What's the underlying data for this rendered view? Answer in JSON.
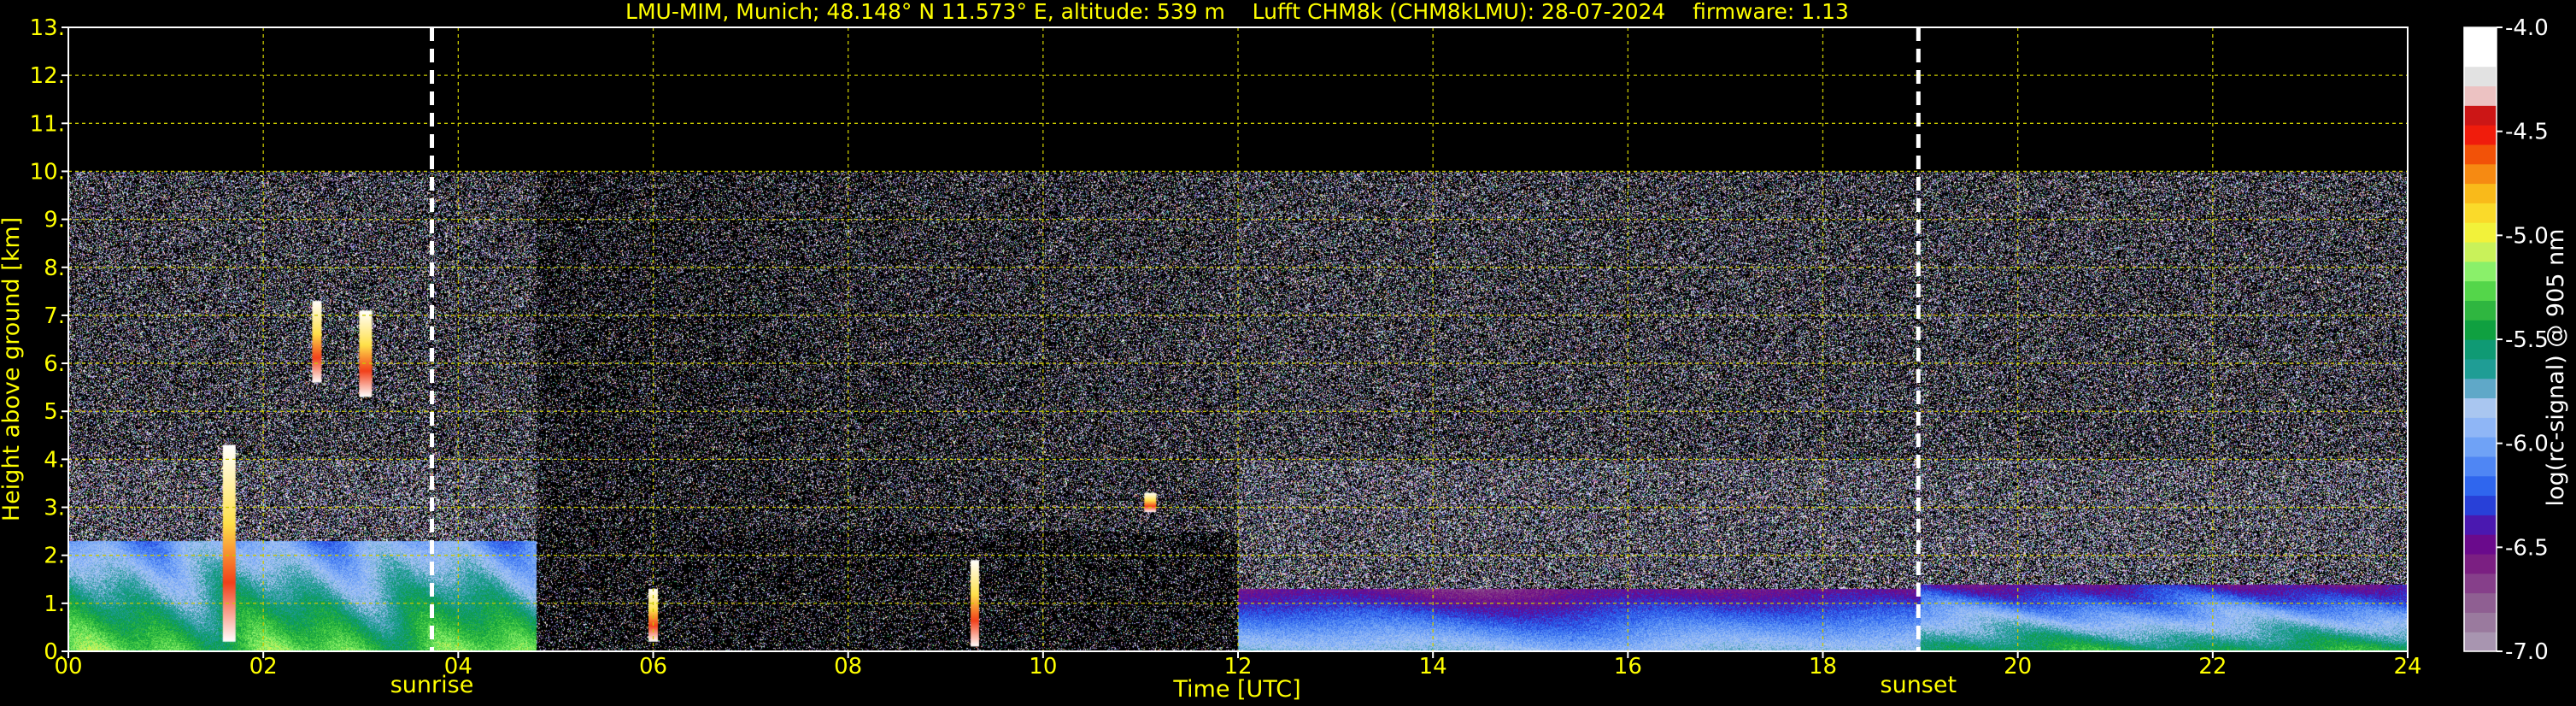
{
  "chart_data": {
    "type": "heatmap",
    "title": "LMU-MIM, Munich; 48.148° N 11.573° E, altitude: 539 m    Lufft CHM8k (CHM8kLMU): 28-07-2024    firmware: 1.13",
    "xlabel": "Time [UTC]",
    "ylabel": "Height above ground [km]",
    "xlim": [
      0,
      24
    ],
    "ylim": [
      0,
      13
    ],
    "x_ticks": [
      "00",
      "02",
      "04",
      "06",
      "08",
      "10",
      "12",
      "14",
      "16",
      "18",
      "20",
      "22",
      "24"
    ],
    "y_ticks": [
      "0.",
      "1.",
      "2.",
      "3.",
      "4.",
      "5.",
      "6.",
      "7.",
      "8.",
      "9.",
      "10.",
      "11.",
      "12.",
      "13."
    ],
    "grid": true,
    "data_top_km": 10.0,
    "colorbar": {
      "label": "log(rc-signal) @ 905 nm",
      "range": [
        -7.0,
        -4.0
      ],
      "ticks": [
        "-4.0",
        "-4.5",
        "-5.0",
        "-5.5",
        "-6.0",
        "-6.5",
        "-7.0"
      ],
      "colors": [
        "#a895b0",
        "#9a7a9e",
        "#8f5f92",
        "#863f8a",
        "#7b1f82",
        "#6a0a8c",
        "#4a18b0",
        "#2840d8",
        "#2f66ee",
        "#4f86f4",
        "#6fa2f6",
        "#8fb6f6",
        "#a9c6f0",
        "#5fa8c8",
        "#1f9d95",
        "#0f9a74",
        "#0fa040",
        "#2fb640",
        "#54d64a",
        "#8af06a",
        "#c9f25a",
        "#f2f23a",
        "#fada2a",
        "#f9ba1a",
        "#f68a12",
        "#f25208",
        "#f01c0c",
        "#cc1616",
        "#ecc2c2",
        "#e2e2e2",
        "#ffffff",
        "#ffffff"
      ]
    },
    "annotations": [
      {
        "label": "sunrise",
        "time": 3.73
      },
      {
        "label": "sunset",
        "time": 18.98
      }
    ],
    "features": [
      {
        "kind": "boundary_layer",
        "from": 0.0,
        "to": 4.8,
        "top_km": 2.3
      },
      {
        "kind": "boundary_layer",
        "from": 12.0,
        "to": 19.0,
        "top_km": 1.3
      },
      {
        "kind": "residual_layer",
        "from": 19.0,
        "to": 24.0,
        "top_km": 1.4
      },
      {
        "kind": "cloud",
        "time": 1.65,
        "base_km": 0.2,
        "top_km": 4.3
      },
      {
        "kind": "cloud",
        "time": 2.55,
        "base_km": 5.6,
        "top_km": 7.3
      },
      {
        "kind": "cloud",
        "time": 3.05,
        "base_km": 5.3,
        "top_km": 7.1
      },
      {
        "kind": "cloud",
        "time": 9.3,
        "base_km": 0.1,
        "top_km": 1.9
      },
      {
        "kind": "cloud",
        "time": 6.0,
        "base_km": 0.2,
        "top_km": 1.3
      },
      {
        "kind": "cloud",
        "time": 11.1,
        "base_km": 2.9,
        "top_km": 3.3
      }
    ]
  }
}
